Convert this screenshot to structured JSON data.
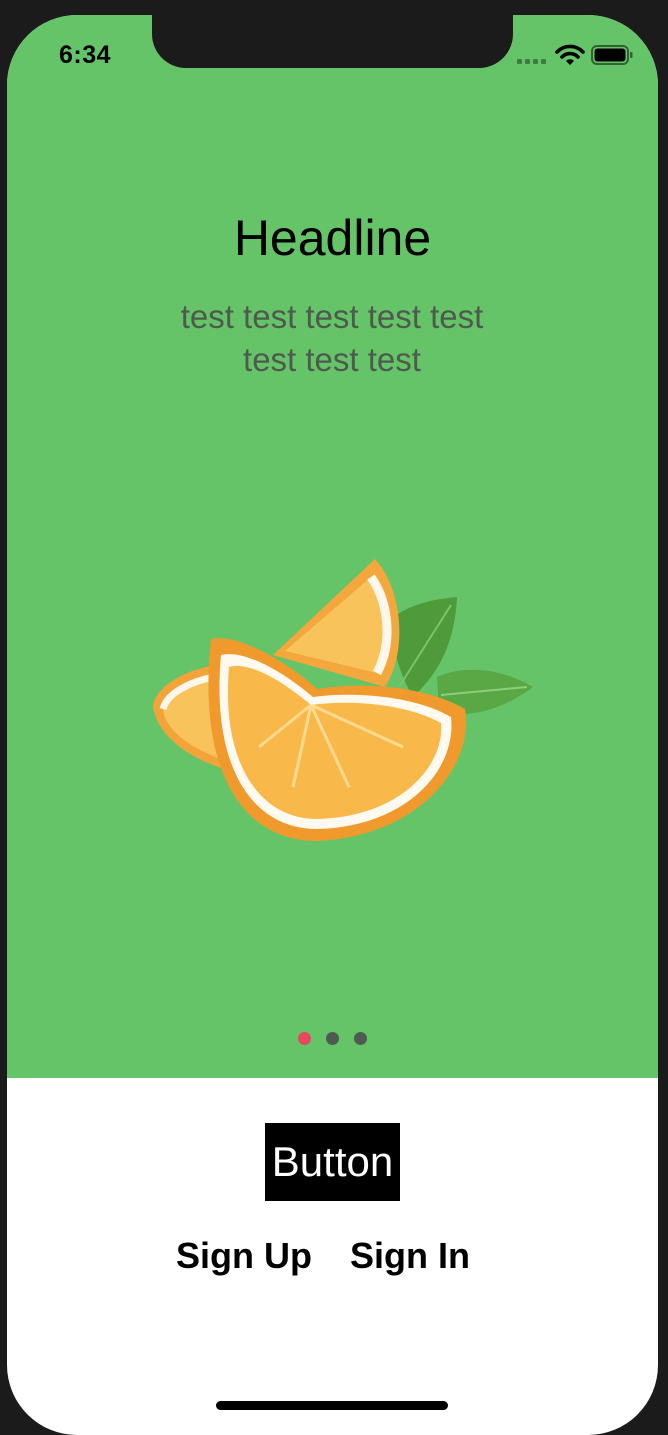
{
  "status_bar": {
    "time": "6:34"
  },
  "onboarding": {
    "headline": "Headline",
    "subtitle_line1": "test test  test test test",
    "subtitle_line2": "test test test",
    "image": "orange-slices-illustration",
    "page_indicator": {
      "total": 3,
      "current": 1
    }
  },
  "actions": {
    "button_label": "Button",
    "sign_up_label": "Sign Up",
    "sign_in_label": "Sign In"
  },
  "colors": {
    "background": "#65c468",
    "active_dot": "#e8475d",
    "inactive_dot": "#4f5a52",
    "button_background": "#000000",
    "button_text": "#ffffff"
  },
  "icons": [
    "signal-icon",
    "wifi-icon",
    "battery-icon"
  ]
}
